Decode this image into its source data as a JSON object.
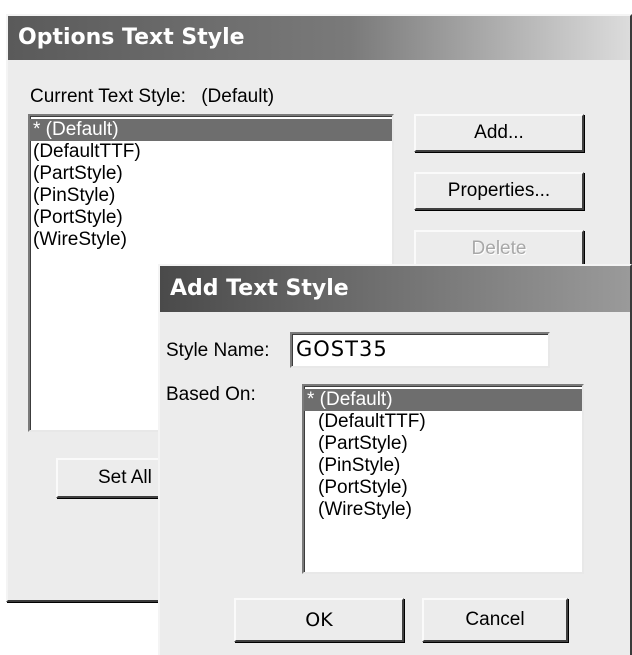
{
  "options_dialog": {
    "title": "Options Text Style",
    "current_label": "Current Text Style:",
    "current_value": "(Default)",
    "styles": [
      "* (Default)",
      "(DefaultTTF)",
      "(PartStyle)",
      "(PinStyle)",
      "(PortStyle)",
      "(WireStyle)"
    ],
    "add_label": "Add...",
    "properties_label": "Properties...",
    "delete_label": "Delete",
    "set_all_label": "Set All"
  },
  "add_dialog": {
    "title": "Add Text Style",
    "style_name_label": "Style Name:",
    "style_name_value": "GOST35",
    "based_on_label": "Based On:",
    "based_on_items": [
      "* (Default)",
      "(DefaultTTF)",
      "(PartStyle)",
      "(PinStyle)",
      "(PortStyle)",
      "(WireStyle)"
    ],
    "ok_label": "OK",
    "cancel_label": "Cancel"
  }
}
